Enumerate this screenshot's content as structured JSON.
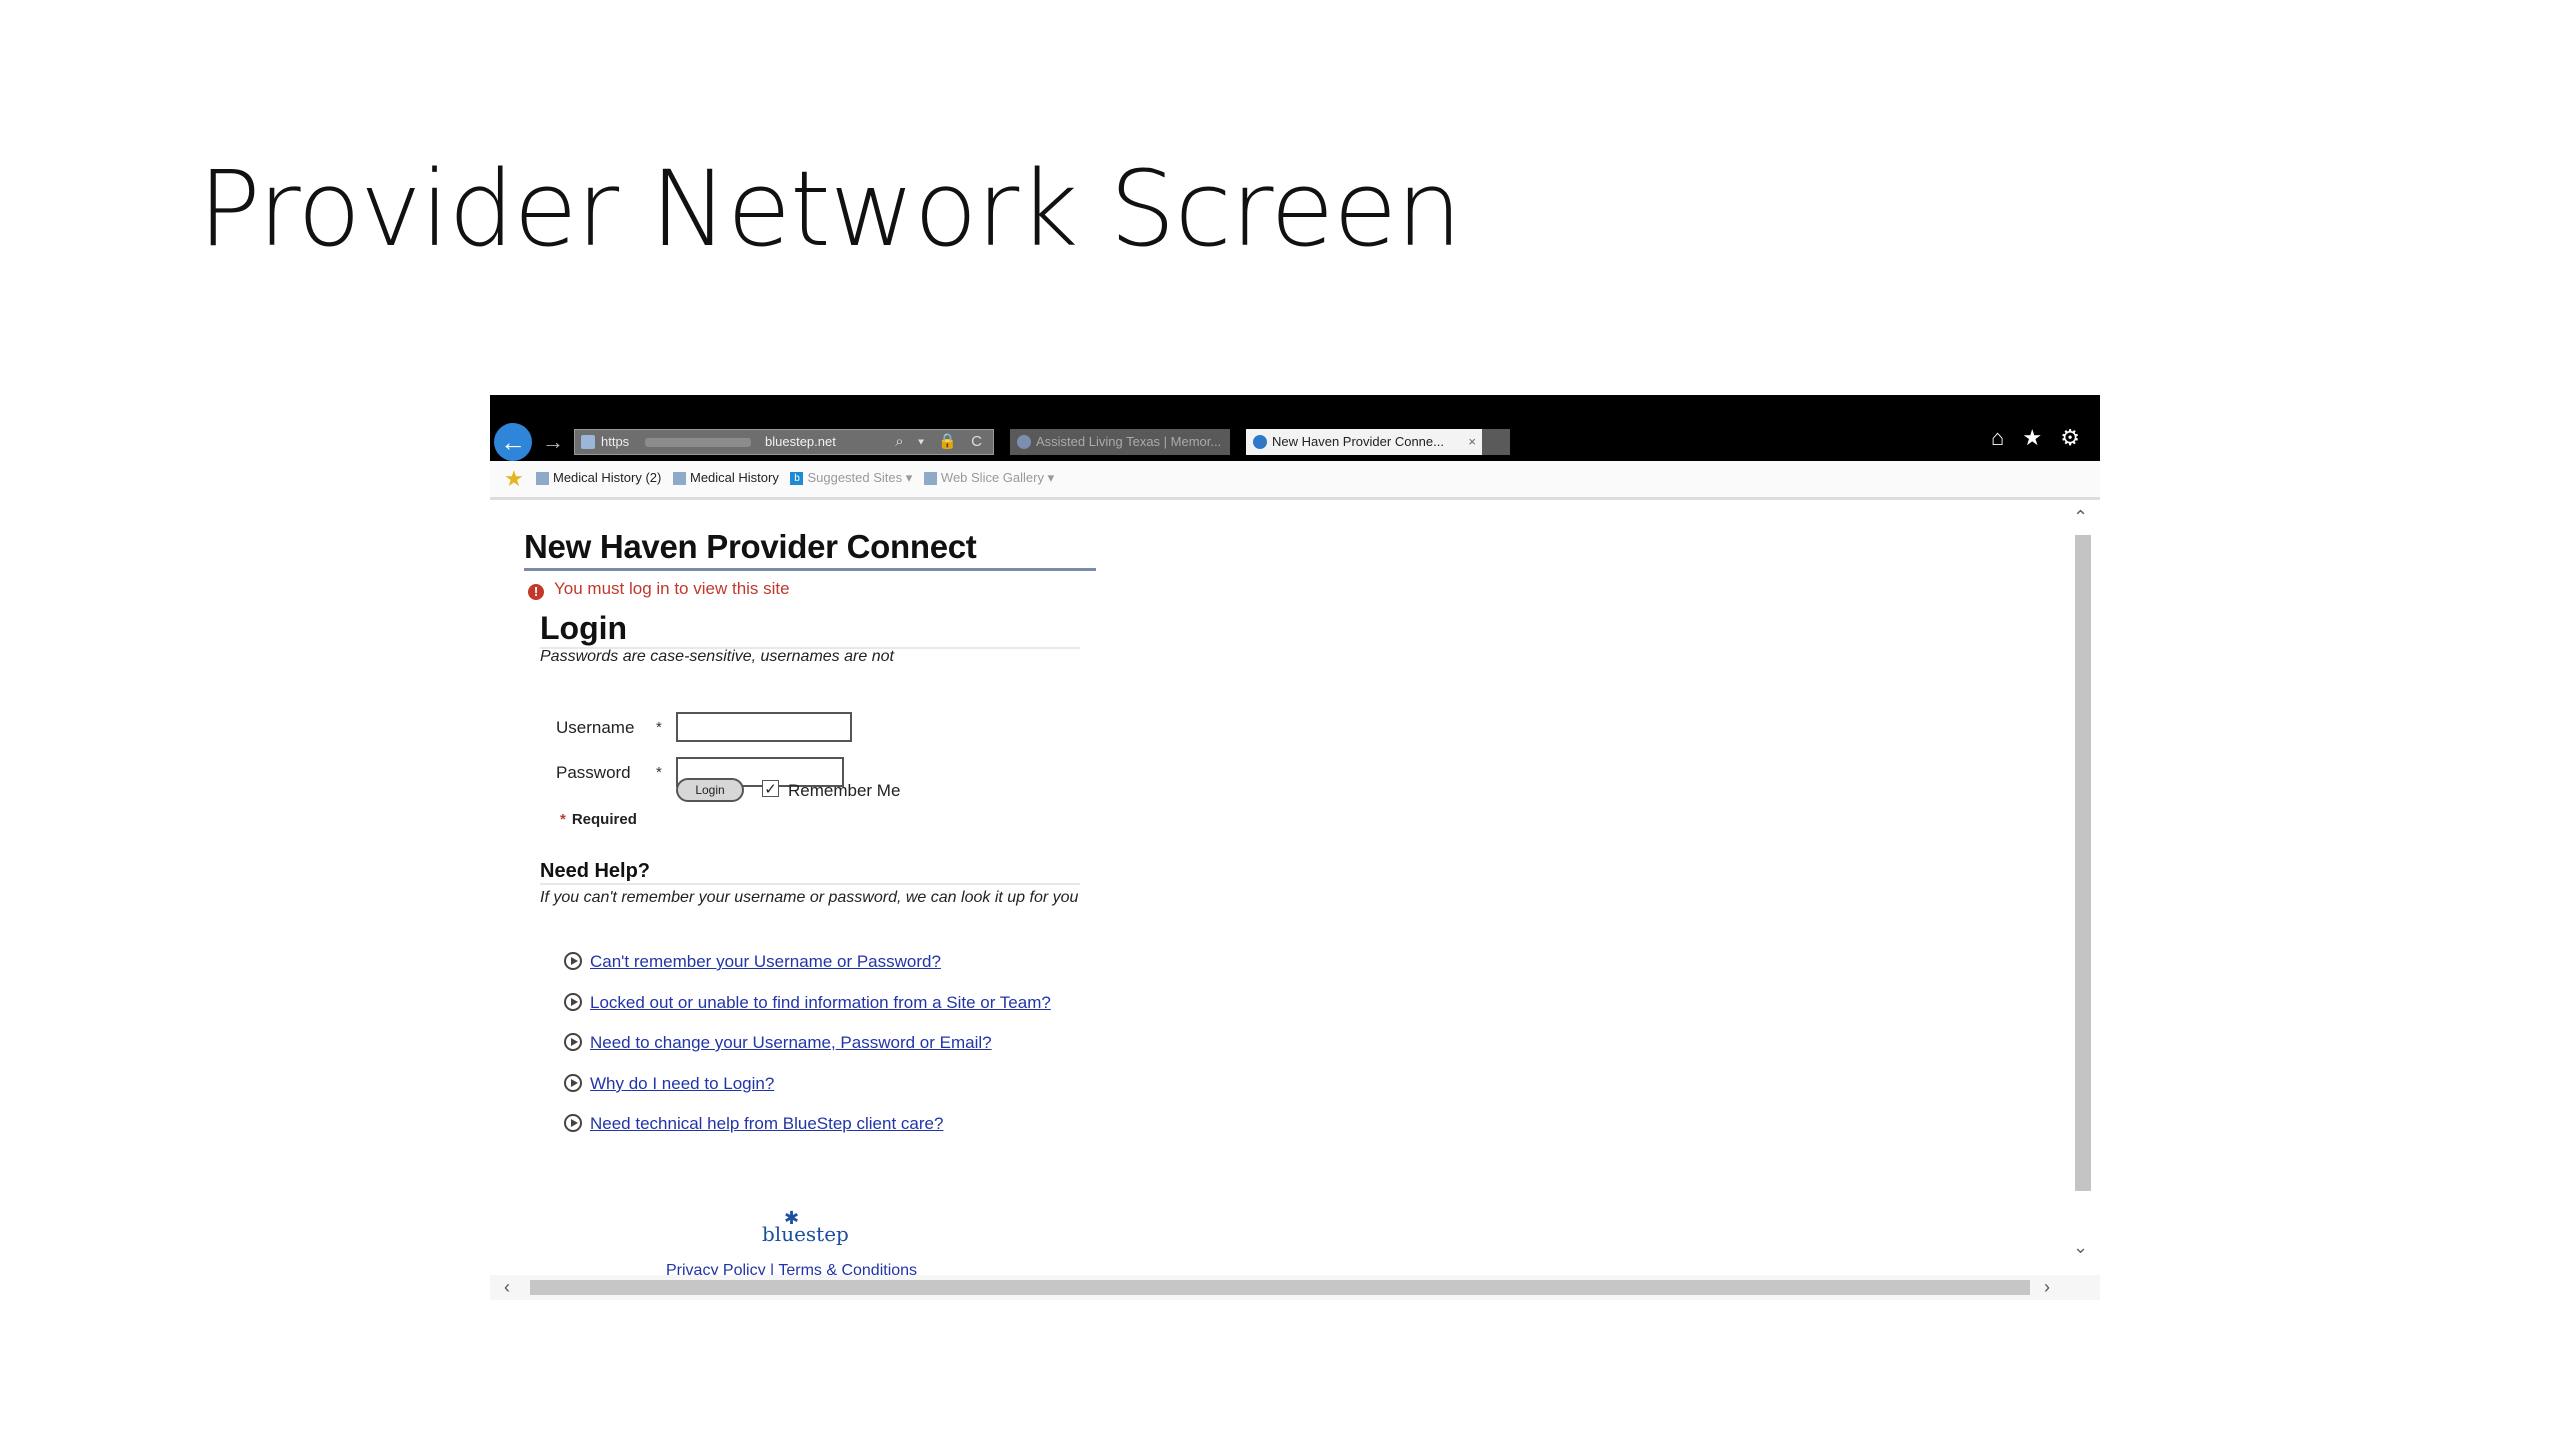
{
  "slide": {
    "title": "Provider Network Screen"
  },
  "browser": {
    "address_scheme": "https",
    "address_domain": "bluestep.net",
    "address_tools": "⌕ ▾ 🔒 C",
    "tabs": [
      {
        "label": "Assisted Living Texas | Memor...",
        "active": false
      },
      {
        "label": "New Haven Provider Conne...",
        "active": true
      }
    ],
    "tab_close": "×",
    "window_icons": "⌂ ★ ⚙",
    "favorites": [
      {
        "label": "Medical History (2)"
      },
      {
        "label": "Medical History"
      },
      {
        "label": "Suggested Sites ▾"
      },
      {
        "label": "Web Slice Gallery ▾"
      }
    ]
  },
  "page": {
    "site_title": "New Haven Provider Connect",
    "warning": "You must log in to view this site",
    "login_heading": "Login",
    "login_subtitle": "Passwords are case-sensitive, usernames are not",
    "username_label": "Username",
    "password_label": "Password",
    "required_star": "*",
    "login_button": "Login",
    "remember_label": "Remember Me",
    "remember_checked": true,
    "required_note": "Required",
    "help_heading": "Need Help?",
    "help_text": "If you can't remember your username or password, we can look it up for you",
    "help_links": [
      "Can't remember your Username or Password?",
      "Locked out or unable to find information from a Site or Team?",
      "Need to change your Username, Password or Email?",
      "Why do I need to Login?",
      "Need technical help from BlueStep client care?"
    ],
    "footer_logo": "bluestep",
    "footer_links": "Privacy Policy | Terms & Conditions"
  }
}
